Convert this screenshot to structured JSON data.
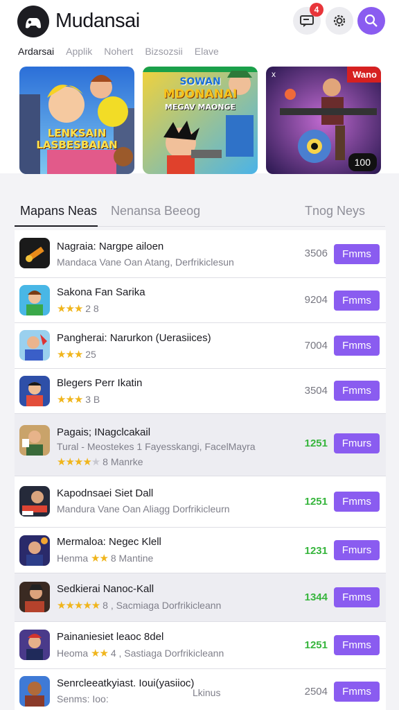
{
  "app": {
    "title": "Mudansai",
    "notification_count": "4"
  },
  "categories": [
    "Ardarsai",
    "Applik",
    "Nohert",
    "Bizsozsii",
    "Elave"
  ],
  "banners": [
    {
      "title": "LENKSAIN LASBESBAIAN"
    },
    {
      "line1": "SOWAN",
      "line2": "MDONANAI",
      "line3": "MEGAV MAONGE"
    },
    {
      "tag": "Wano",
      "close": "x",
      "count": "100"
    }
  ],
  "tabs": [
    "Mapans Neas",
    "Nenansa Beeog",
    "Tnog Neys"
  ],
  "items": [
    {
      "title": "Nagraia: Nargpe ailoen",
      "sub": "Mandaca Vane Oan Atang, Derfrikiclesun",
      "num": "3506",
      "btn": "Fmms"
    },
    {
      "title": "Sakona Fan Sarika",
      "stars": "★★★",
      "sub": "2  8",
      "num": "9204",
      "btn": "Fmms"
    },
    {
      "title": "Pangherai: Narurkon (Uerasiices)",
      "stars": "★★★",
      "sub": "25",
      "num": "7004",
      "btn": "Fmms"
    },
    {
      "title": "Blegers Perr Ikatin",
      "stars": "★★★",
      "sub": "3  B",
      "num": "3504",
      "btn": "Fmms"
    },
    {
      "title": "Pagais; INagclcakail",
      "sub": "Tural - Meostekes 1 Fayesskangi, FacelMayra",
      "stars": "★★★★",
      "stars_off": "★",
      "sub2": "8  Manrke",
      "num": "1251",
      "btn": "Fmurs"
    },
    {
      "title": "Kapodnsaei Siet Dall",
      "sub": "Mandura Vane Oan Aliagg Dorfrikicleurn",
      "num": "1251",
      "btn": "Fmms"
    },
    {
      "title": "Mermaloa: Negec Klell",
      "sub_pre": "Henma",
      "stars": "★★",
      "sub": "8   Mantine",
      "num": "1231",
      "btn": "Fmurs"
    },
    {
      "title": "Sedkierai Nanoc-Kall",
      "stars": "★★★★★",
      "sub": "8 , Sacmiaga Dorfrikicleann",
      "num": "1344",
      "btn": "Fmms"
    },
    {
      "title": "Painaniesiet leaoc 8del",
      "sub_pre": "Heoma",
      "stars": "★★",
      "sub": "4 , Sastiaga Dorfrikicleann",
      "num": "1251",
      "btn": "Fmms"
    },
    {
      "title": "Senrcleeatkyiast. Ioui(yasiioc)",
      "sub": "Senms: Ioo:",
      "side": "Lkinus",
      "num": "2504",
      "btn": "Fmms"
    }
  ],
  "colors": {
    "accent": "#8a5cf0",
    "badge": "#e8353a",
    "star": "#f0b51c",
    "green": "#36b53c"
  }
}
